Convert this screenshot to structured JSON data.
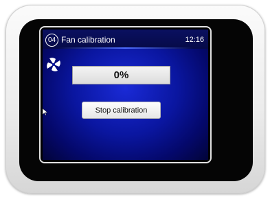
{
  "header": {
    "step_number": "04",
    "title": "Fan calibration",
    "time": "12:16"
  },
  "progress": {
    "label": "0%",
    "value": 0
  },
  "actions": {
    "stop_label": "Stop calibration"
  },
  "icons": {
    "fan": "fan-icon"
  },
  "colors": {
    "screen_background": "#0a16a0",
    "progress_fill": "#6f8cff"
  }
}
